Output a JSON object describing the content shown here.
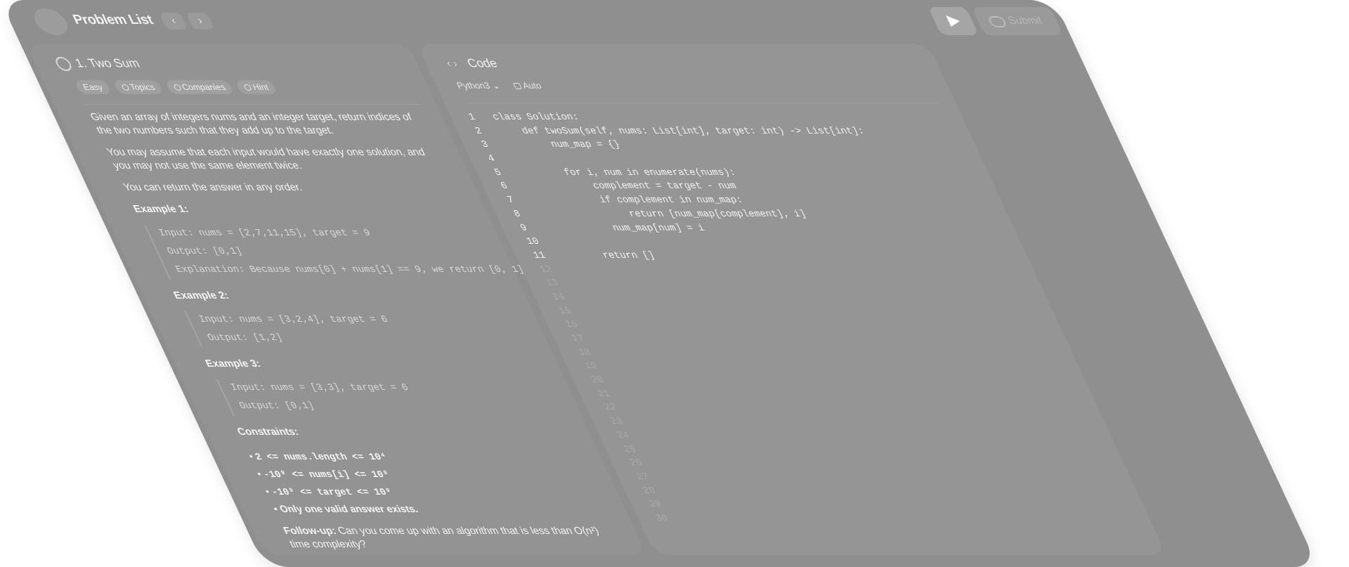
{
  "header": {
    "title": "Problem List",
    "prev_icon": "chevron-left-icon",
    "next_icon": "chevron-right-icon",
    "run_icon": "play-icon",
    "submit_label": "Submit",
    "submit_icon": "cloud-upload-icon"
  },
  "description": {
    "title": "1. Two Sum",
    "title_icon": "lightbulb-icon",
    "tags": [
      {
        "label": "Easy"
      },
      {
        "label": "Topics",
        "icon": "tag-icon"
      },
      {
        "label": "Companies",
        "icon": "building-icon"
      },
      {
        "label": "Hint",
        "icon": "bulb-icon"
      }
    ],
    "paragraphs": [
      "Given an array of integers nums and an integer target, return indices of the two numbers such that they add up to the target.",
      "You may assume that each input would have exactly one solution, and you may not use the same element twice.",
      "You can return the answer in any order."
    ],
    "examples": [
      {
        "title": "Example 1:",
        "lines": [
          "Input: nums = [2,7,11,15], target = 9",
          "Output: [0,1]",
          "Explanation: Because nums[0] + nums[1] == 9, we return [0, 1]."
        ]
      },
      {
        "title": "Example 2:",
        "lines": [
          "Input: nums = [3,2,4], target = 6",
          "Output: [1,2]"
        ]
      },
      {
        "title": "Example 3:",
        "lines": [
          "Input: nums = [3,3], target = 6",
          "Output: [0,1]"
        ]
      }
    ],
    "constraints_title": "Constraints:",
    "constraints": [
      "2 <= nums.length <= 10⁴",
      "-10⁹ <= nums[i] <= 10⁹",
      "-10⁹ <= target <= 10⁹",
      "Only one valid answer exists."
    ],
    "followup_label": "Follow-up:",
    "followup_text": "Can you come up with an algorithm that is less than O(n²) time complexity?"
  },
  "code": {
    "title": "Code",
    "title_icon": "code-icon",
    "language": "Python3",
    "language_icon": "chevron-down-icon",
    "mode": "Auto",
    "mode_icon": "lock-icon",
    "lines": [
      "class Solution:",
      "    def twoSum(self, nums: List[int], target: int) -> List[int]:",
      "        num_map = {}",
      "",
      "        for i, num in enumerate(nums):",
      "            complement = target - num",
      "            if complement in num_map:",
      "                return [num_map[complement], i]",
      "            num_map[num] = i",
      "",
      "        return []"
    ],
    "empty_line_numbers": [
      "12",
      "13",
      "14",
      "15",
      "16",
      "17",
      "18",
      "19",
      "20",
      "21",
      "22",
      "23",
      "24",
      "25",
      "26",
      "27",
      "28",
      "29",
      "30"
    ]
  }
}
